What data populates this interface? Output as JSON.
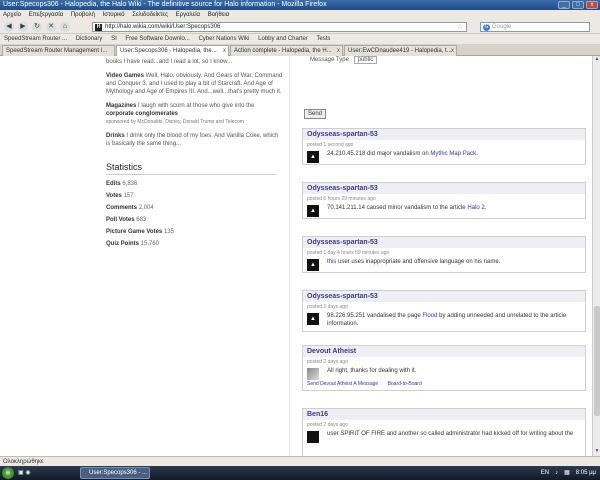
{
  "window": {
    "title": "User:Specops306 - Halopedia, the Halo Wiki - The definitive source for Halo information - Mozilla Firefox"
  },
  "menu": [
    "Αρχείο",
    "Επεξεργασία",
    "Προβολή",
    "Ιστορικό",
    "Σελιδοδείκτες",
    "Εργαλεία",
    "Βοήθεια"
  ],
  "nav": {
    "url": "http://halo.wikia.com/wiki/User:Specops306",
    "search_placeholder": "Google"
  },
  "bookmarks": [
    "SpeedStream Router ...",
    "Dictionary",
    "SI",
    "Free Software Downlo...",
    "Cyber Nations Wiki",
    "Lobby and Charter",
    "Tests"
  ],
  "tabs": [
    {
      "label": "SpeedStream Router Management I..."
    },
    {
      "label": "User:Specops306 - Halopedia, the..."
    },
    {
      "label": "Action complete - Halopedia, the H..."
    },
    {
      "label": "User:EwCDnaudee419 - Halopedia, t..."
    }
  ],
  "profile": {
    "intro": "books I have read...and I read a lot, so I know...",
    "video_games_label": "Video Games",
    "video_games": "Well, Halo, obviously. And Gears of War, Command and Conquer 3, and I used to play a bit of Starcraft. And Age of Mythology and Age of Empires III. And...well...that's pretty much it.",
    "magazines_label": "Magazines",
    "magazines": "I laugh with scorn at those who give into the",
    "magazines_bold": "corporate conglomerates",
    "sponsored": "sponsored by McDonalds, Disney, Donald Trump and Telecom",
    "drinks_label": "Drinks",
    "drinks": "I drink only the blood of my foes. And Vanilla Coke, which is basically the same thing..."
  },
  "statistics": {
    "heading": "Statistics",
    "items": [
      {
        "label": "Edits",
        "value": "6,836"
      },
      {
        "label": "Votes",
        "value": "157"
      },
      {
        "label": "Comments",
        "value": "2,004"
      },
      {
        "label": "Poll Votes",
        "value": "683"
      },
      {
        "label": "Picture Game Votes",
        "value": "135"
      },
      {
        "label": "Quiz Points",
        "value": "15,760"
      }
    ]
  },
  "board": {
    "message_type_label": "Message Type",
    "message_type_value": "public",
    "send_label": "Send",
    "comments": [
      {
        "user": "Odysseas-spartan-53",
        "meta": "posted 1 second ago",
        "pre": "24.210.45.218 did major vandalism on ",
        "link": "Mythic Map Pack",
        "post": "."
      },
      {
        "user": "Odysseas-spartan-53",
        "meta": "posted 6 hours 29 minutes ago",
        "pre": "70.141.211.14 caused minor vandalism to the article ",
        "link": "Halo 2",
        "post": "."
      },
      {
        "user": "Odysseas-spartan-53",
        "meta": "posted 1 day 4 hours 59 minutes ago",
        "pre": "",
        "link": "this",
        "post": " user uses inappropriate and offensive language on his name."
      },
      {
        "user": "Odysseas-spartan-53",
        "meta": "posted 2 days ago",
        "pre": "98.226.95.251 vandalised the page ",
        "link": "Flood",
        "post": " by adding unneeded and unrelated to the article information."
      },
      {
        "user": "Devout Atheist",
        "meta": "posted 2 days ago",
        "pre": "All right, thanks for dealing with it.",
        "link": "",
        "post": "",
        "foot1": "Send Devout Atheist A Message",
        "foot2": "Board-to-Board"
      },
      {
        "user": "Ben16",
        "meta": "posted 2 days ago",
        "pre": "user SPIRIT OF FIRE and another so called administrator had kicked off for writing about the",
        "link": "",
        "post": ""
      }
    ]
  },
  "status": {
    "text": "Ολοκληρώθηκε"
  },
  "taskbar": {
    "item": "User:Specops306 - ...",
    "lang": "EN",
    "time": "8:05 μμ"
  }
}
